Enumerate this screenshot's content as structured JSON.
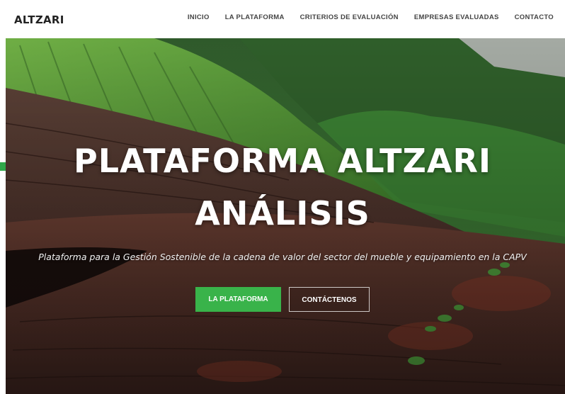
{
  "brand": {
    "logo": "ALTZARI"
  },
  "nav": {
    "items": [
      {
        "label": "INICIO"
      },
      {
        "label": "LA PLATAFORMA"
      },
      {
        "label": "CRITERIOS DE EVALUACIÓN"
      },
      {
        "label": "EMPRESAS EVALUADAS"
      },
      {
        "label": "CONTACTO"
      }
    ]
  },
  "hero": {
    "title_line1": "PLATAFORMA ALTZARI",
    "title_line2": "ANÁLISIS",
    "subtitle": "Plataforma para la Gestión Sostenible de la cadena de valor del sector del mueble y equipamiento en la CAPV",
    "primary_button": "LA PLATAFORMA",
    "secondary_button": "CONTÁCTENOS"
  },
  "colors": {
    "accent": "#39b34a",
    "nav_text": "#444444",
    "logo": "#222222"
  }
}
